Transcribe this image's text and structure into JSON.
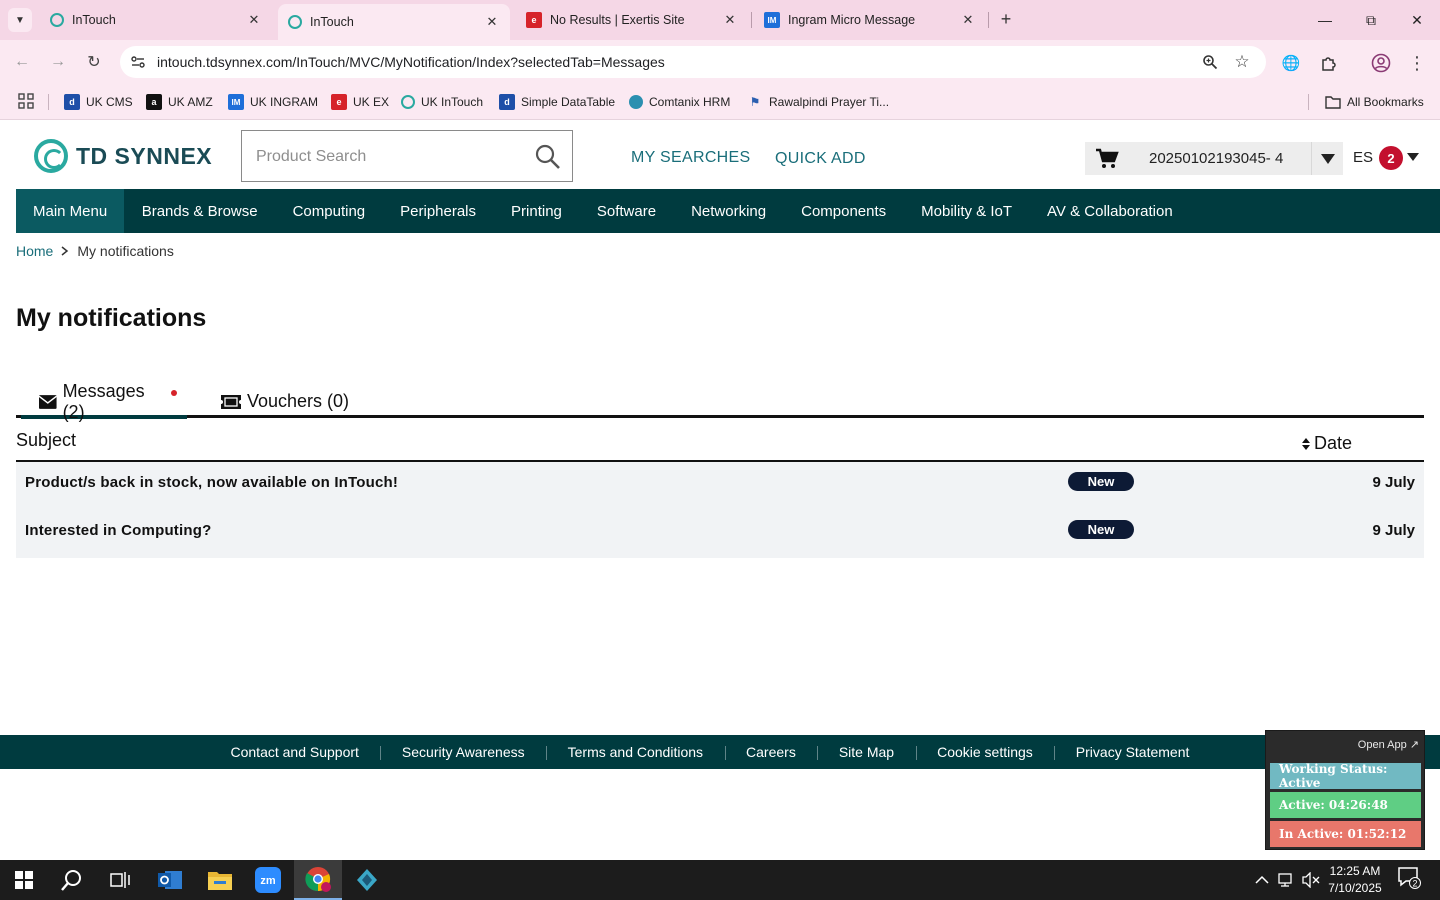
{
  "browser": {
    "tabs": [
      {
        "title": "InTouch",
        "icon": "td-synnex-favicon"
      },
      {
        "title": "InTouch",
        "icon": "td-synnex-favicon"
      },
      {
        "title": "No Results | Exertis Site",
        "icon": "exertis-favicon"
      },
      {
        "title": "Ingram Micro Message",
        "icon": "ingram-micro-favicon"
      }
    ],
    "url": "intouch.tdsynnex.com/InTouch/MVC/MyNotification/Index?selectedTab=Messages",
    "bookmarks": [
      {
        "label": "UK CMS",
        "icon": "ingram-micro-favicon"
      },
      {
        "label": "UK AMZ",
        "icon": "amazon-favicon"
      },
      {
        "label": "UK INGRAM",
        "icon": "ingram-micro-favicon"
      },
      {
        "label": "UK EX",
        "icon": "exertis-favicon"
      },
      {
        "label": "UK InTouch",
        "icon": "td-synnex-favicon"
      },
      {
        "label": "Simple DataTable",
        "icon": "datatable-favicon"
      },
      {
        "label": "Comtanix HRM",
        "icon": "hrm-favicon"
      },
      {
        "label": "Rawalpindi Prayer Ti...",
        "icon": "prayer-favicon"
      }
    ],
    "all_bookmarks": "All Bookmarks"
  },
  "header": {
    "logo_text": "TD SYNNEX",
    "search_placeholder": "Product Search",
    "my_searches": "MY SEARCHES",
    "quick_add": "QUICK ADD",
    "cart_number": "20250102193045- 4",
    "user_initials": "ES",
    "notification_count": "2"
  },
  "nav": {
    "items": [
      "Main Menu",
      "Brands & Browse",
      "Computing",
      "Peripherals",
      "Printing",
      "Software",
      "Networking",
      "Components",
      "Mobility & IoT",
      "AV & Collaboration"
    ]
  },
  "breadcrumb": {
    "home": "Home",
    "current": "My notifications"
  },
  "page": {
    "title": "My notifications",
    "tabs": {
      "messages": "Messages (2)",
      "vouchers": "Vouchers (0)"
    },
    "columns": {
      "subject": "Subject",
      "date": "Date"
    },
    "rows": [
      {
        "subject": "Product/s back in stock, now available on InTouch!",
        "badge": "New",
        "date": "9 July"
      },
      {
        "subject": "Interested in Computing?",
        "badge": "New",
        "date": "9 July"
      }
    ]
  },
  "footer": {
    "links": [
      "Contact and Support",
      "Security Awareness",
      "Terms and Conditions",
      "Careers",
      "Site Map",
      "Cookie settings",
      "Privacy Statement"
    ]
  },
  "widget": {
    "open_app": "Open App ↗",
    "working_status": "Working Status: Active",
    "active": "Active: 04:26:48",
    "inactive": "In Active: 01:52:12"
  },
  "taskbar": {
    "time": "12:25 AM",
    "date": "7/10/2025",
    "notification_count": "2"
  },
  "colors": {
    "brand_dark": "#003b3f",
    "brand_teal": "#2aa9a0",
    "link_teal": "#1a6e7a",
    "badge_red": "#c3102e",
    "new_badge": "#0d1a35"
  }
}
